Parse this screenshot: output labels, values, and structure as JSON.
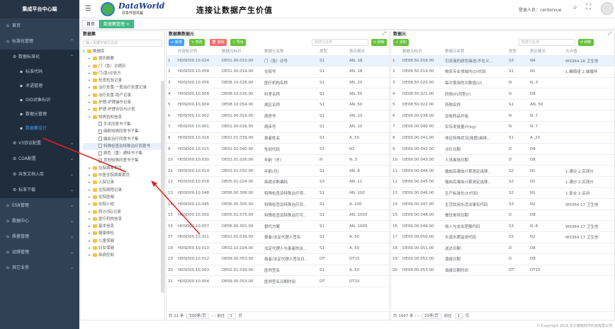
{
  "sidebar": {
    "title": "集成平台中心端",
    "items": [
      {
        "label": "首页",
        "icon": "home-icon",
        "level": 0
      },
      {
        "label": "标准化管理",
        "icon": "standard-icon",
        "level": 0,
        "chevron": "up-chevron-icon"
      },
      {
        "label": "数据标准化",
        "icon": "gear-icon",
        "level": 1,
        "chevron": "up-chevron-icon"
      },
      {
        "label": "标准代码",
        "icon": "code-icon",
        "level": 2
      },
      {
        "label": "术语管理",
        "icon": "term-icon",
        "level": 2
      },
      {
        "label": "OID对象标识",
        "icon": "oid-icon",
        "level": 2
      },
      {
        "label": "数据元管理",
        "icon": "element-icon",
        "level": 2
      },
      {
        "label": "数据集设计",
        "icon": "dataset-icon",
        "level": 2,
        "active": true
      },
      {
        "label": "V3协议配置",
        "icon": "protocol-icon",
        "level": 1,
        "chevron": "down-chevron-icon"
      },
      {
        "label": "CDA配置",
        "icon": "cda-icon",
        "level": 1,
        "chevron": "down-chevron-icon"
      },
      {
        "label": "共享文档入库",
        "icon": "document-icon",
        "level": 1,
        "chevron": "down-chevron-icon"
      },
      {
        "label": "标准下载",
        "icon": "download-icon",
        "level": 1,
        "chevron": "down-chevron-icon"
      },
      {
        "label": "ESB管理",
        "icon": "esb-icon",
        "level": 0,
        "chevron": "down-chevron-icon"
      },
      {
        "label": "数据中心",
        "icon": "data-center-icon",
        "level": 0,
        "chevron": "down-chevron-icon"
      },
      {
        "label": "质量管理",
        "icon": "quality-icon",
        "level": 0,
        "chevron": "down-chevron-icon"
      },
      {
        "label": "运维管理",
        "icon": "ops-icon",
        "level": 0,
        "chevron": "down-chevron-icon"
      },
      {
        "label": "其它业务",
        "icon": "other-icon",
        "level": 0,
        "chevron": "down-chevron-icon"
      }
    ]
  },
  "header": {
    "brand": "DataWorld",
    "brand_sub": "共享开放共赢",
    "slogan": "连接让数据产生价值",
    "login_label": "登录人员：centervue"
  },
  "tabs": [
    {
      "label": "首页",
      "active": false
    },
    {
      "label": "数据集管理 ×",
      "active": true
    }
  ],
  "tree": {
    "title": "数据集",
    "search_placeholder": "输入关键字进行过滤",
    "nodes": [
      {
        "label": "数据库",
        "level": 0,
        "type": "folder",
        "expanded": true
      },
      {
        "label": "病历概要",
        "level": 1,
        "type": "folder"
      },
      {
        "label": "门（急）诊病历",
        "level": 1,
        "type": "folder"
      },
      {
        "label": "门(急)诊处方",
        "level": 1,
        "type": "folder"
      },
      {
        "label": "检查检验记录",
        "level": 1,
        "type": "folder"
      },
      {
        "label": "治疗处置-一般治疗处置记录",
        "level": 1,
        "type": "folder"
      },
      {
        "label": "治疗处置-助产记录",
        "level": 1,
        "type": "folder"
      },
      {
        "label": "护理-护理操作记录",
        "level": 1,
        "type": "folder"
      },
      {
        "label": "护理-护理评估与计划",
        "level": 1,
        "type": "folder"
      },
      {
        "label": "知情告知信息",
        "level": 1,
        "type": "folder",
        "expanded": true
      },
      {
        "label": "手术同意书子集",
        "level": 2,
        "type": "file"
      },
      {
        "label": "麻醉知情同意书子集",
        "level": 2,
        "type": "file"
      },
      {
        "label": "输血治疗同意书子集",
        "level": 2,
        "type": "file"
      },
      {
        "label": "特殊检查及特殊治疗同意书",
        "level": 2,
        "type": "file",
        "selected": true
      },
      {
        "label": "病危（重）通知书子集",
        "level": 2,
        "type": "file"
      },
      {
        "label": "其他知情同意书子集",
        "level": 2,
        "type": "file"
      },
      {
        "label": "住院病案首页",
        "level": 1,
        "type": "folder"
      },
      {
        "label": "中医住院病案首页",
        "level": 1,
        "type": "folder"
      },
      {
        "label": "入院记录",
        "level": 1,
        "type": "folder"
      },
      {
        "label": "住院病程记录",
        "level": 1,
        "type": "folder"
      },
      {
        "label": "住院医嘱",
        "level": 1,
        "type": "folder"
      },
      {
        "label": "出院小结",
        "level": 1,
        "type": "folder"
      },
      {
        "label": "转诊(院)记录",
        "level": 1,
        "type": "folder"
      },
      {
        "label": "医疗机构信息",
        "level": 1,
        "type": "folder"
      },
      {
        "label": "基本信息",
        "level": 1,
        "type": "folder"
      },
      {
        "label": "健康体检",
        "level": 1,
        "type": "folder"
      },
      {
        "label": "儿童保健",
        "level": 1,
        "type": "folder"
      },
      {
        "label": "妇女保健",
        "level": 1,
        "type": "folder"
      },
      {
        "label": "疾病控制",
        "level": 1,
        "type": "folder"
      }
    ]
  },
  "dataset_panel": {
    "title": "数据集数据元",
    "buttons": {
      "add": "+ 新增",
      "edit": "✎ 修改",
      "delete": "🗑 删除",
      "export": "⇪ 导出"
    },
    "search_placeholder": "数据元名称",
    "refresh": "⟳ 刷新",
    "columns": [
      "",
      "内部标识符",
      "数据元标识",
      "数据元名称",
      "类型",
      "表达格式"
    ],
    "rows": [
      [
        "1",
        "HDSD00.10.024",
        "DE01.00.010.00",
        "门（急）诊号",
        "S1",
        "AN..18"
      ],
      [
        "2",
        "HDSD00.10.058",
        "DE01.00.014.00",
        "住院号",
        "S1",
        "AN..18"
      ],
      [
        "3",
        "HDSD00.10.056",
        "DE08.10.026.00",
        "医疗机构名称",
        "S1",
        "AN..20"
      ],
      [
        "4",
        "HDSD00.10.008",
        "DE08.10.026.00",
        "科室名称",
        "S1",
        "AN..50"
      ],
      [
        "5",
        "HDSD00.10.004",
        "DE08.10.054.00",
        "病区名称",
        "S1",
        "AN..50"
      ],
      [
        "6",
        "HDSD00.10.002",
        "DE01.00.019.00",
        "病房号",
        "S1",
        "AN..10"
      ],
      [
        "7",
        "HDSD00.10.001",
        "DE01.00.026.00",
        "病床号",
        "S1",
        "AN..10"
      ],
      [
        "8",
        "HDSD00.10.016",
        "DE02.01.039.00",
        "患者姓名",
        "S1",
        "A..50"
      ],
      [
        "9",
        "HDSD00.10.015",
        "DE02.01.040.00",
        "性别代码",
        "S3",
        "N1"
      ],
      [
        "10",
        "HDSD00.10.030",
        "DE02.01.026.00",
        "年龄（岁）",
        "N",
        "N..3"
      ],
      [
        "11",
        "HDSD00.10.019",
        "DE02.01.032.00",
        "年龄(月)",
        "S1",
        "AN..8"
      ],
      [
        "12",
        "HDSD00.10.018",
        "DE05.01.024.00",
        "疾病诊断编码",
        "S3",
        "AN..11"
      ],
      [
        "13",
        "HDSD00.10.048",
        "DE06.00.306.00",
        "特殊检查及特殊治疗项...",
        "S1",
        "AN..100"
      ],
      [
        "14",
        "HDSD00.10.045",
        "DE06.00.305.00",
        "特殊检查及特殊治疗目...",
        "S1",
        "A..100"
      ],
      [
        "15",
        "HDSD00.10.050",
        "DE05.01.075.00",
        "特殊检查及特殊治疗可...",
        "S1",
        "AN..1000"
      ],
      [
        "16",
        "HDSD00.10.057",
        "DE06.00.301.00",
        "替代方案",
        "S1",
        "AN..1000"
      ],
      [
        "17",
        "HDSD00.10.011",
        "DE02.01.039.00",
        "患者/法定代理人签名",
        "S1",
        "A..50"
      ],
      [
        "18",
        "HDSD00.10.010",
        "DE02.10.024.00",
        "法定代理人与患者的关...",
        "S1",
        "A..50"
      ],
      [
        "19",
        "HDSD00.10.012",
        "DE09.00.053.00",
        "患者/法定代理人签名日...",
        "DT",
        "DT15"
      ],
      [
        "20",
        "HDSD00.10.003",
        "DE02.01.039.00",
        "医师签名",
        "S1",
        "A..50"
      ],
      [
        "21",
        "HDSD00.10.054",
        "DE09.00.053.00",
        "医师签名日期时间",
        "DT",
        "DT15"
      ]
    ],
    "pager": {
      "total": "共 21 条",
      "size": "500条/页",
      "goto": "前往",
      "page": "1",
      "suffix": "页"
    }
  },
  "element_panel": {
    "title": "数据元",
    "buttons": {
      "add": "+ 添加"
    },
    "search_placeholder": "数据元名称",
    "refresh": "⟳ 刷新",
    "columns": [
      "",
      "数据元标识",
      "数据元名称",
      "类型",
      "表达格式",
      "允许值"
    ],
    "rows": [
      [
        "1",
        "DE08.50.018.00",
        "引流液的颜色描述(不在义...",
        "S3",
        "N4",
        "WS364.16 卫生信"
      ],
      [
        "2",
        "DE08.50.019.00",
        "物流专业领域内(D)代码",
        "S1",
        "N1",
        "1.癫痫组 2.抽搐伴"
      ],
      [
        "3",
        "DE08.50.020.00",
        "每次使用的次数值(U)",
        "N",
        "N..3",
        ""
      ],
      [
        "4",
        "DE08.50.021.00",
        "药物(P)剂型(t)",
        "D",
        "D8",
        ""
      ],
      [
        "5",
        "DE08.50.022.00",
        "药物名称",
        "S1",
        "AN..50",
        ""
      ],
      [
        "6",
        "DE09.00.038.00",
        "没收药品开始",
        "N",
        "N..7",
        ""
      ],
      [
        "7",
        "DE09.00.040.00",
        "实际发放量计(kg)",
        "N",
        "N..7",
        ""
      ],
      [
        "8",
        "DE09.00.041.00",
        "体征特殊状况(简图)具体...",
        "S1",
        "A..20",
        ""
      ],
      [
        "9",
        "DE09.00.042.00",
        "诊疗日期",
        "D",
        "D8",
        ""
      ],
      [
        "10",
        "DE09.00.043.00",
        "人员离场日期",
        "D",
        "D8",
        ""
      ],
      [
        "11",
        "DE09.00.044.00",
        "输血后凝血计算测定选择...",
        "S2",
        "N1",
        "1.满分 2.实测分"
      ],
      [
        "12",
        "DE09.00.045.00",
        "输血后凝血计算测定选择...",
        "S2",
        "N1",
        "1.满分 2.实测分"
      ],
      [
        "13",
        "DE09.00.046.00",
        "生产标准化(X)代码",
        "S2",
        "N1",
        "1.复合 2.关闭"
      ],
      [
        "14",
        "DE09.00.047.00",
        "生活饮用水违法事实代码",
        "S3",
        "N2",
        "WS364.17 卫生信"
      ],
      [
        "15",
        "DE09.00.048.00",
        "餐饮单项日期",
        "D",
        "D8",
        ""
      ],
      [
        "16",
        "DE09.00.049.00",
        "收入与支出差额代码",
        "S3",
        "N..6",
        "WS364.17 卫生信"
      ],
      [
        "17",
        "DE09.00.050.00",
        "水源水质监测代码",
        "S3",
        "N2",
        "WS364.17 卫生信"
      ],
      [
        "18",
        "DE09.00.051.00",
        "送达日期",
        "D",
        "D8",
        ""
      ],
      [
        "19",
        "DE09.00.052.00",
        "填报日期",
        "D",
        "D8",
        ""
      ],
      [
        "20",
        "DE09.00.053.00",
        "填报日期时间",
        "DT",
        "DT15",
        ""
      ]
    ],
    "pager": {
      "total": "共 1667 条",
      "size": "20条/页",
      "goto": "前往",
      "page": "1",
      "suffix": "页"
    }
  },
  "footer": "© Copyright 2016 长沙泰锐软件科技有限公司"
}
